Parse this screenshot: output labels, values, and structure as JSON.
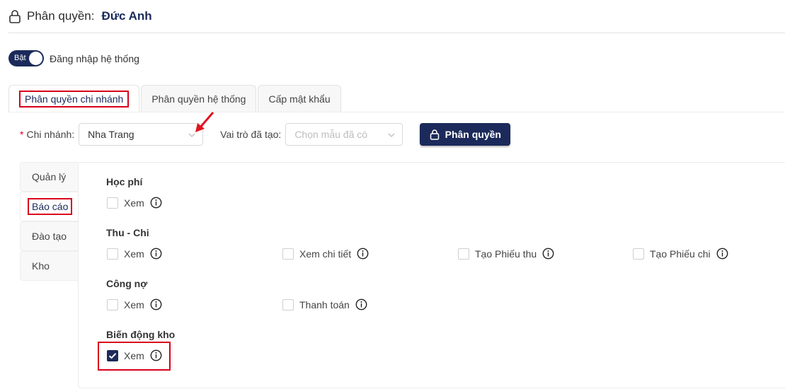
{
  "header": {
    "label": "Phân quyền:",
    "name": "Đức Anh"
  },
  "login_toggle": {
    "state_label": "Bật",
    "label": "Đăng nhập hệ thống",
    "on": true
  },
  "tabs": [
    {
      "label": "Phân quyền chi nhánh",
      "active": true
    },
    {
      "label": "Phân quyền hệ thống",
      "active": false
    },
    {
      "label": "Cấp mật khẩu",
      "active": false
    }
  ],
  "filters": {
    "required_mark": "*",
    "branch_label": "Chi nhánh:",
    "branch_value": "Nha Trang",
    "role_label": "Vai trò đã tạo:",
    "role_placeholder": "Chọn mẫu đã có",
    "permission_button": "Phân quyền"
  },
  "sidebar": [
    {
      "label": "Quản lý",
      "active": false
    },
    {
      "label": "Báo cáo",
      "active": true
    },
    {
      "label": "Đào tạo",
      "active": false
    },
    {
      "label": "Kho",
      "active": false
    }
  ],
  "groups": [
    {
      "title": "Học phí",
      "items": [
        {
          "label": "Xem",
          "checked": false
        }
      ]
    },
    {
      "title": "Thu - Chi",
      "items": [
        {
          "label": "Xem",
          "checked": false
        },
        {
          "label": "Xem chi tiết",
          "checked": false
        },
        {
          "label": "Tạo Phiếu thu",
          "checked": false
        },
        {
          "label": "Tạo Phiếu chi",
          "checked": false
        }
      ]
    },
    {
      "title": "Công nợ",
      "items": [
        {
          "label": "Xem",
          "checked": false
        },
        {
          "label": "Thanh toán",
          "checked": false
        }
      ]
    },
    {
      "title": "Biến động kho",
      "items": [
        {
          "label": "Xem",
          "checked": true
        }
      ]
    }
  ],
  "colors": {
    "primary": "#1b2a5a",
    "highlight": "#d9001b",
    "border": "#d9d9d9"
  }
}
